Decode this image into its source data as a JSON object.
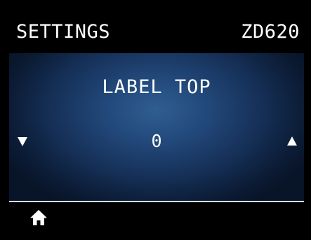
{
  "header": {
    "title": "SETTINGS",
    "model": "ZD620"
  },
  "setting": {
    "name": "LABEL TOP",
    "value": "0"
  },
  "controls": {
    "decrease_icon": "triangle-down-icon",
    "increase_icon": "triangle-up-icon",
    "home_icon": "home-icon"
  },
  "colors": {
    "header_bg": "#000000",
    "screen_bg_center": "#2f5e92",
    "screen_bg_edge": "#081428",
    "text": "#ffffff",
    "divider": "#d8dde6"
  }
}
